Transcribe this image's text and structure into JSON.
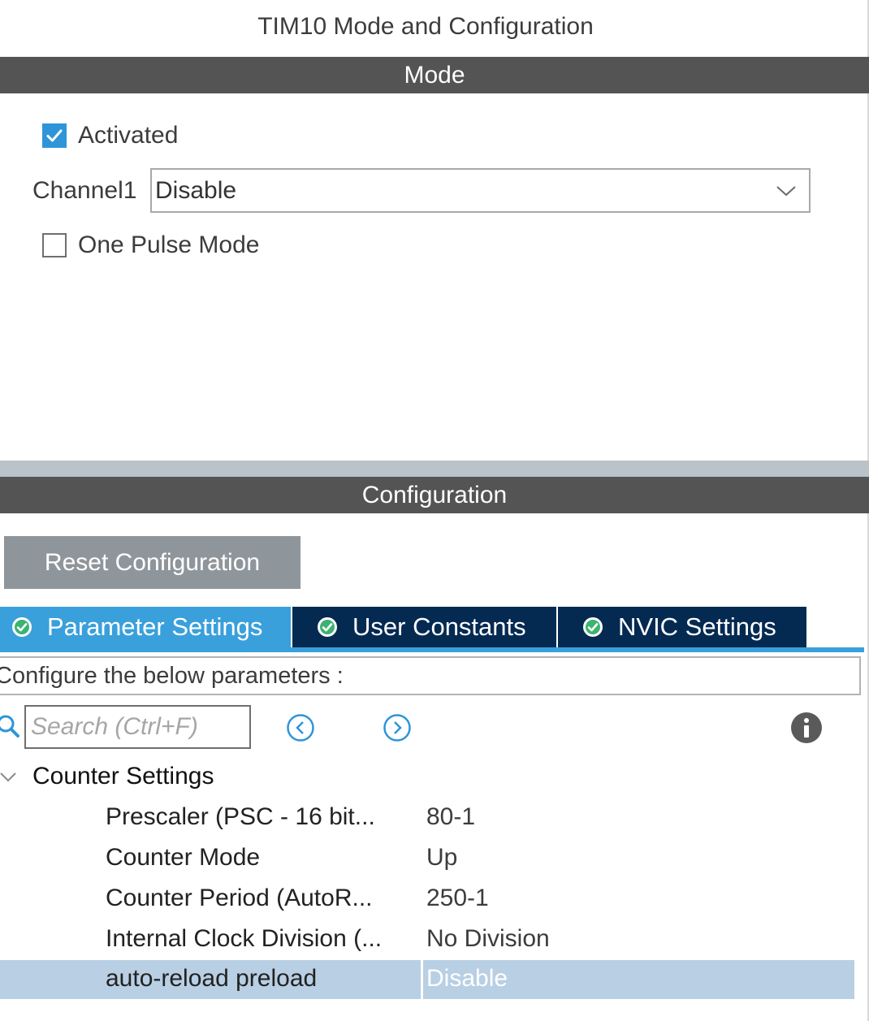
{
  "window": {
    "title": "TIM10 Mode and Configuration"
  },
  "mode": {
    "header": "Mode",
    "activated_label": "Activated",
    "activated_checked": true,
    "channel1_label": "Channel1",
    "channel1_value": "Disable",
    "one_pulse_label": "One Pulse Mode",
    "one_pulse_checked": false
  },
  "config": {
    "header": "Configuration",
    "reset_label": "Reset Configuration",
    "tabs": [
      {
        "label": "Parameter Settings",
        "active": true
      },
      {
        "label": "User Constants",
        "active": false
      },
      {
        "label": "NVIC Settings",
        "active": false
      }
    ],
    "configure_text": "Configure the below parameters :",
    "search_placeholder": "Search (Ctrl+F)",
    "group_title": "Counter Settings",
    "params": [
      {
        "name": "Prescaler (PSC - 16 bit...",
        "value": "80-1"
      },
      {
        "name": "Counter Mode",
        "value": "Up"
      },
      {
        "name": "Counter Period (AutoR...",
        "value": "250-1"
      },
      {
        "name": "Internal Clock Division (...",
        "value": "No Division"
      },
      {
        "name": "auto-reload preload",
        "value": "Disable"
      }
    ]
  },
  "colors": {
    "header_bg": "#545454",
    "tab_active": "#3aa0dc",
    "tab_inactive": "#052a52",
    "checkbox_checked": "#2f95d8",
    "selected_row": "#b8cfe4",
    "reset_button": "#8f969b"
  },
  "icons": {
    "search": "search-icon",
    "prev": "circle-chevron-left-icon",
    "next": "circle-chevron-right-icon",
    "info": "info-icon",
    "tab_status": "check-circle-icon",
    "dropdown": "chevron-down-icon"
  }
}
